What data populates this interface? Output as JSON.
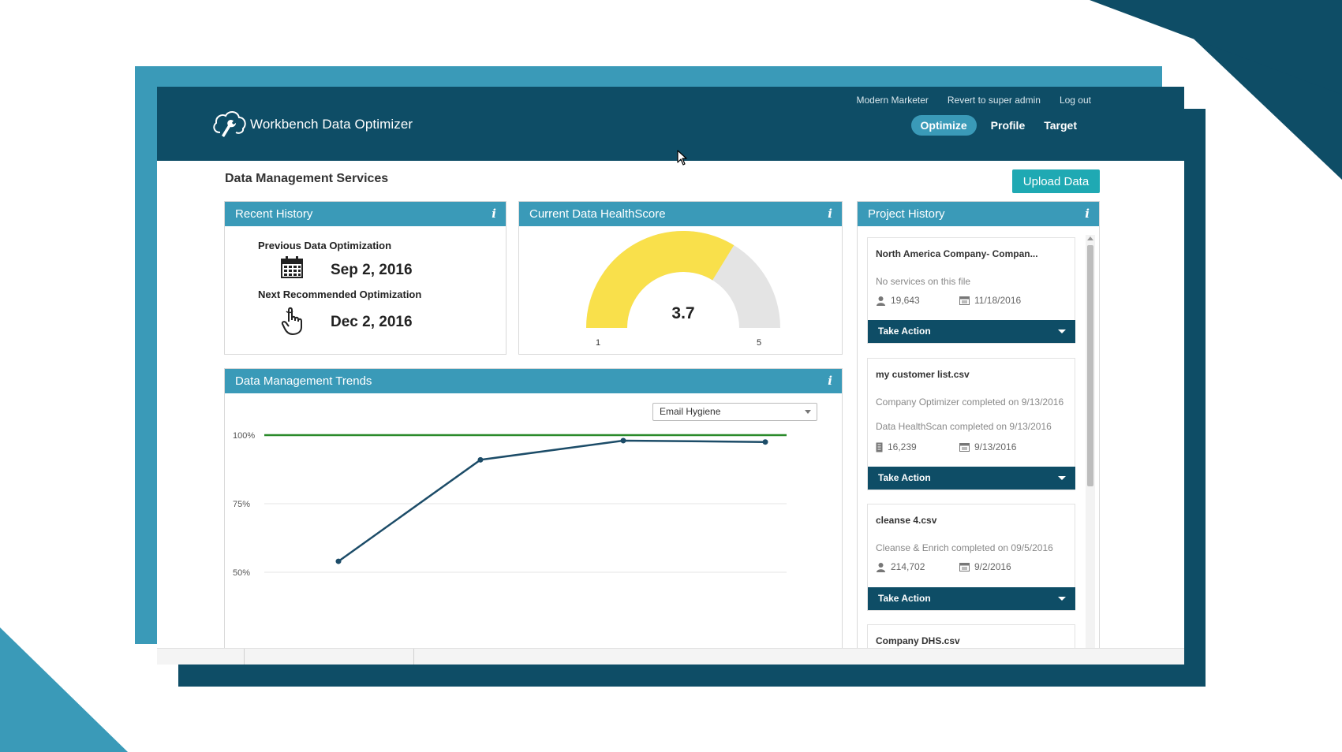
{
  "header": {
    "app_title": "Workbench Data Optimizer",
    "top_links": [
      "Modern Marketer",
      "Revert to super admin",
      "Log out"
    ],
    "nav_tabs": [
      "Optimize",
      "Profile",
      "Target"
    ],
    "active_tab": "Optimize"
  },
  "main": {
    "section_title": "Data Management Services",
    "upload_label": "Upload Data"
  },
  "recent_history": {
    "title": "Recent History",
    "info": "i",
    "previous_label": "Previous Data Optimization",
    "previous_date": "Sep 2, 2016",
    "next_label": "Next Recommended Optimization",
    "next_date": "Dec 2, 2016"
  },
  "health_score": {
    "title": "Current Data HealthScore",
    "info": "i",
    "score_text": "3.7",
    "score": 3.7,
    "min_label": "1",
    "max_label": "5",
    "colors": {
      "fill": "#f9e04b",
      "track": "#e4e4e4"
    }
  },
  "trends": {
    "title": "Data Management Trends",
    "info": "i",
    "filter_value": "Email Hygiene"
  },
  "chart_data": {
    "type": "line",
    "y_ticks": [
      "100%",
      "75%",
      "50%"
    ],
    "ylim": [
      50,
      100
    ],
    "series": [
      {
        "values": [
          54,
          91,
          98,
          97.5
        ],
        "color": "#1c4c68"
      }
    ],
    "target_line": {
      "value": 100,
      "color": "#2a8a2a"
    }
  },
  "project_history": {
    "title": "Project History",
    "info": "i",
    "items": [
      {
        "name": "North America Company- Compan...",
        "lines": [
          "No services on this file"
        ],
        "count": "19,643",
        "date": "11/18/2016",
        "action": "Take Action"
      },
      {
        "name": "my customer list.csv",
        "lines": [
          "Company Optimizer completed on 9/13/2016",
          "Data HealthScan completed on 9/13/2016"
        ],
        "count": "16,239",
        "date": "9/13/2016",
        "action": "Take Action"
      },
      {
        "name": "cleanse 4.csv",
        "lines": [
          "Cleanse & Enrich completed on 09/5/2016"
        ],
        "count": "214,702",
        "date": "9/2/2016",
        "action": "Take Action"
      },
      {
        "name": "Company DHS.csv"
      }
    ]
  }
}
